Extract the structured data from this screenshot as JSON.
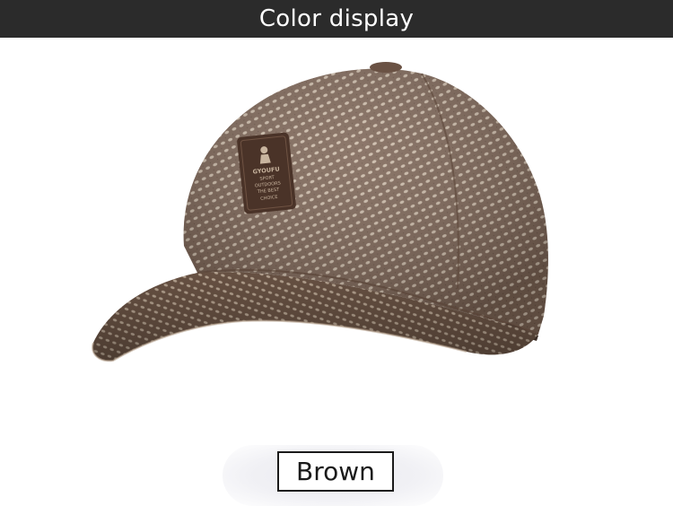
{
  "header": {
    "title": "Color display"
  },
  "product": {
    "patch_lines": [
      "GYOUFU",
      "SPORT",
      "OUTDOORS",
      "THE BEST",
      "CHOICE"
    ],
    "color_name": "Brown",
    "colors": {
      "header_bg": "#2b2b2b",
      "cap_base": "#8a7060",
      "cap_light": "#c9b8a6",
      "patch": "#4a3328"
    }
  }
}
